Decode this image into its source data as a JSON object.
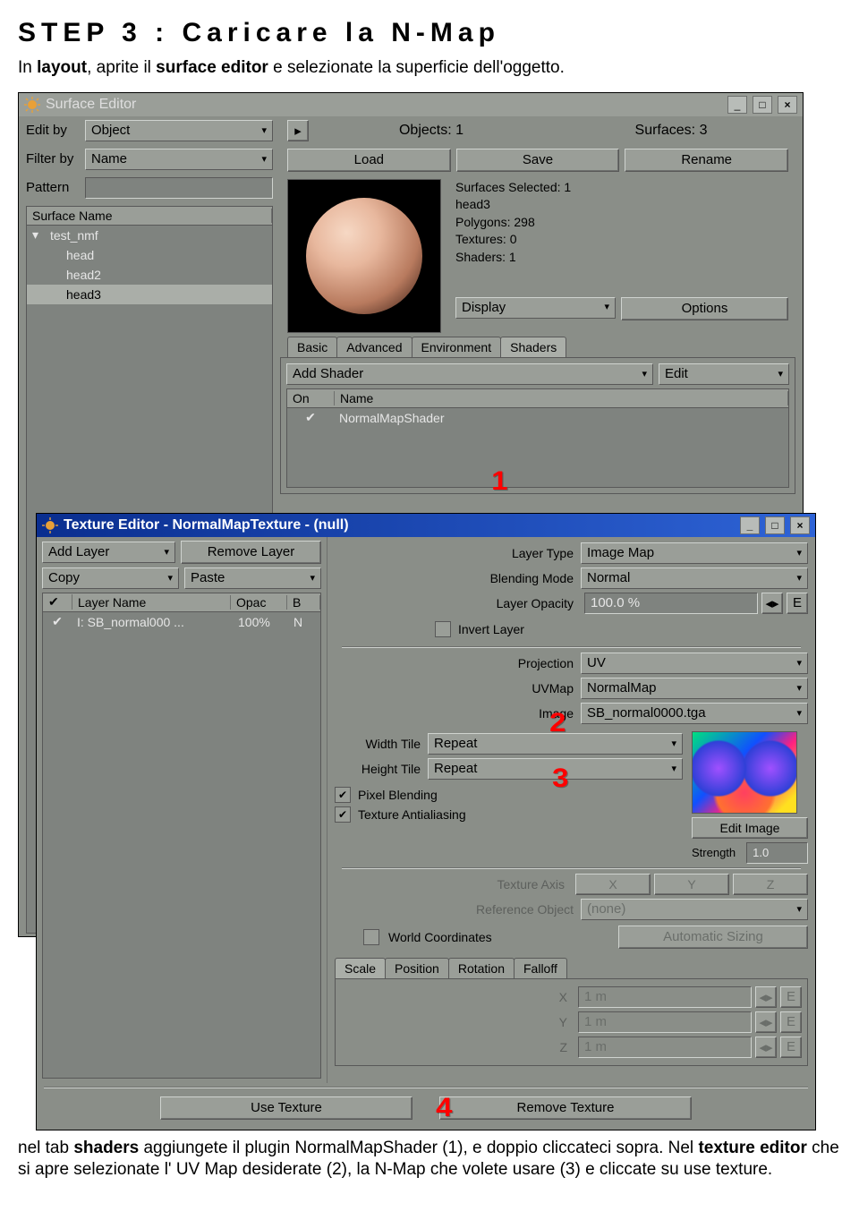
{
  "heading": "STEP 3 : Caricare la N-Map",
  "intro": {
    "p1a": "In ",
    "p1b_bold": "layout",
    "p1c": ", aprite il ",
    "p1d_bold": "surface editor",
    "p1e": " e selezionate la superficie dell'oggetto."
  },
  "callouts": {
    "c1": "1",
    "c2": "2",
    "c3": "3",
    "c4": "4"
  },
  "surface_editor": {
    "title": "Surface Editor",
    "edit_by_lbl": "Edit by",
    "edit_by_val": "Object",
    "filter_by_lbl": "Filter by",
    "filter_by_val": "Name",
    "pattern_lbl": "Pattern",
    "objects_lbl": "Objects: 1",
    "surfaces_lbl": "Surfaces: 3",
    "load": "Load",
    "save": "Save",
    "rename": "Rename",
    "info_selected": "Surfaces Selected: 1",
    "info_name": "head3",
    "info_polys": "Polygons: 298",
    "info_tex": "Textures: 0",
    "info_shaders": "Shaders: 1",
    "display": "Display",
    "options": "Options",
    "list_header": "Surface Name",
    "items": [
      "test_nmf",
      "head",
      "head2",
      "head3"
    ],
    "tabs": [
      "Basic",
      "Advanced",
      "Environment",
      "Shaders"
    ],
    "add_shader": "Add Shader",
    "edit": "Edit",
    "shader_cols": {
      "on": "On",
      "name": "Name"
    },
    "shader_row": "NormalMapShader"
  },
  "texture_editor": {
    "title": "Texture Editor - NormalMapTexture - (null)",
    "add_layer": "Add Layer",
    "remove_layer": "Remove Layer",
    "copy": "Copy",
    "paste": "Paste",
    "layer_cols": {
      "name": "Layer Name",
      "opac": "Opac",
      "b": "B"
    },
    "layer_row": {
      "name": "I:  SB_normal000 ...",
      "opac": "100%",
      "b": "N"
    },
    "layer_type_lbl": "Layer Type",
    "layer_type_val": "Image Map",
    "blend_lbl": "Blending Mode",
    "blend_val": "Normal",
    "opacity_lbl": "Layer Opacity",
    "opacity_val": "100.0 %",
    "invert_lbl": "Invert Layer",
    "projection_lbl": "Projection",
    "projection_val": "UV",
    "uvmap_lbl": "UVMap",
    "uvmap_val": "NormalMap",
    "image_lbl": "Image",
    "image_val": "SB_normal0000.tga",
    "width_tile_lbl": "Width Tile",
    "width_tile_val": "Repeat",
    "height_tile_lbl": "Height Tile",
    "height_tile_val": "Repeat",
    "pixel_blending": "Pixel Blending",
    "tex_aa": "Texture Antialiasing",
    "edit_image": "Edit Image",
    "strength_lbl": "Strength",
    "strength_val": "1.0",
    "tex_axis_lbl": "Texture Axis",
    "axis_x": "X",
    "axis_y": "Y",
    "axis_z": "Z",
    "ref_obj_lbl": "Reference Object",
    "ref_obj_val": "(none)",
    "world_coords": "World Coordinates",
    "auto_sizing": "Automatic Sizing",
    "tabs2": [
      "Scale",
      "Position",
      "Rotation",
      "Falloff"
    ],
    "xyz": {
      "x_lbl": "X",
      "x_val": "1 m",
      "y_lbl": "Y",
      "y_val": "1 m",
      "z_lbl": "Z",
      "z_val": "1 m"
    },
    "use_texture": "Use Texture",
    "remove_texture": "Remove Texture",
    "e_btn": "E",
    "arrows": "◂▸"
  },
  "outro": {
    "p2a": "nel tab ",
    "p2b_bold": "shaders",
    "p2c": " aggiungete il plugin NormalMapShader  (1),  e doppio cliccateci sopra. Nel ",
    "p2d_bold": "texture editor",
    "p2e": " che si apre selezionate l' UV Map desiderate (2), la N-Map che volete usare (3) e cliccate su use texture."
  }
}
